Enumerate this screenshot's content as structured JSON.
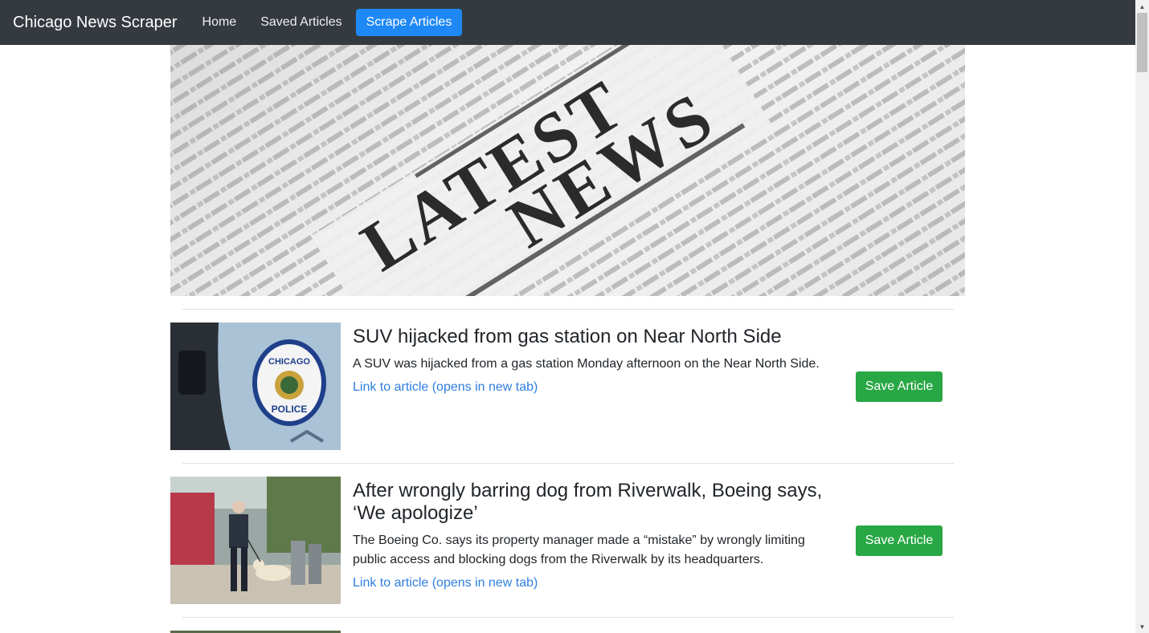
{
  "navbar": {
    "brand": "Chicago News Scraper",
    "links": [
      {
        "label": "Home"
      },
      {
        "label": "Saved Articles"
      },
      {
        "label": "Scrape Articles"
      }
    ]
  },
  "hero": {
    "headline_line1": "LATEST",
    "headline_line2": "NEWS"
  },
  "articles": [
    {
      "title": "SUV hijacked from gas station on Near North Side",
      "summary": "A SUV was hijacked from a gas station Monday afternoon on the Near North Side.",
      "link_label": "Link to article (opens in new tab)",
      "save_label": "Save Article",
      "badge_line1": "CHICAGO",
      "badge_line2": "POLICE"
    },
    {
      "title": "After wrongly barring dog from Riverwalk, Boeing says, ‘We apologize’",
      "summary": "The Boeing Co. says its property manager made a “mistake” by wrongly limiting public access and blocking dogs from the Riverwalk by its headquarters.",
      "link_label": "Link to article (opens in new tab)",
      "save_label": "Save Article"
    }
  ],
  "colors": {
    "navbar_bg": "#343a40",
    "active_nav": "#1e88f5",
    "save_button": "#28a745",
    "link": "#2f7fe0"
  }
}
